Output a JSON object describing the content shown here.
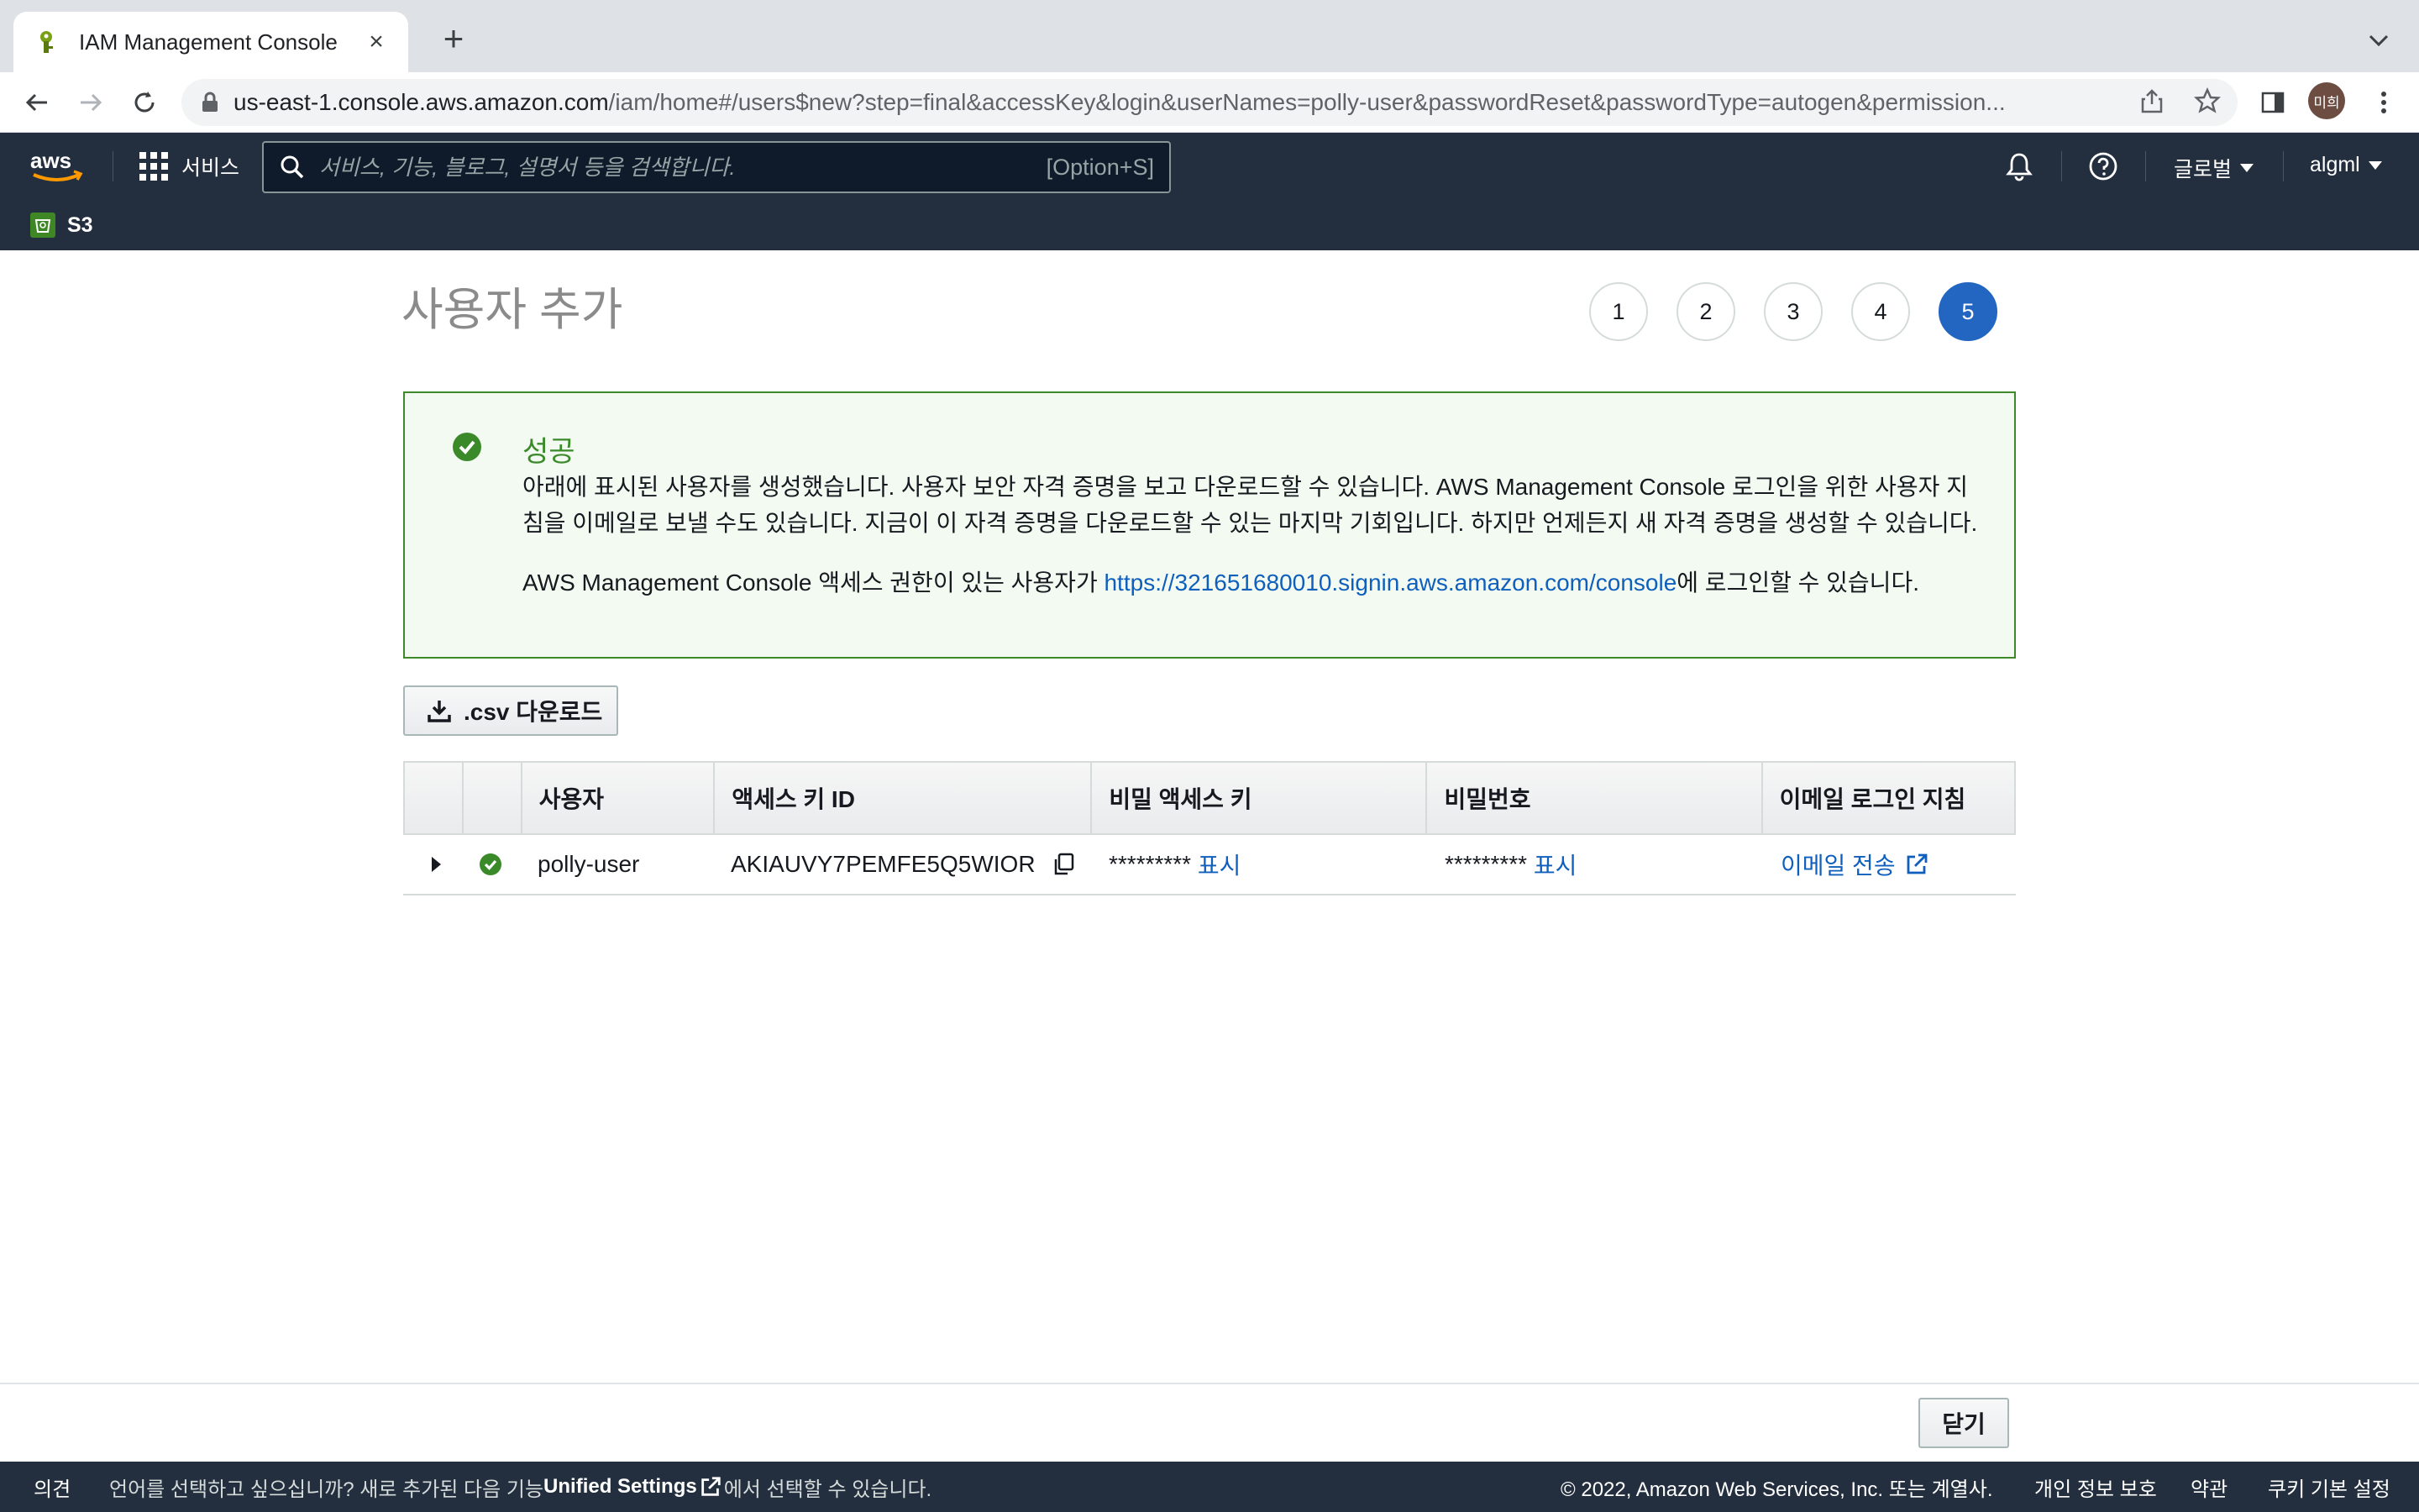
{
  "browser": {
    "tab_title": "IAM Management Console",
    "new_tab": "+",
    "url_host": "us-east-1.console.aws.amazon.com",
    "url_path": "/iam/home#/users$new?step=final&accessKey&login&userNames=polly-user&passwordReset&passwordType=autogen&permission...",
    "profile_initials": "미희"
  },
  "aws_nav": {
    "services_label": "서비스",
    "search_placeholder": "서비스, 기능, 블로그, 설명서 등을 검색합니다.",
    "search_shortcut": "[Option+S]",
    "region": "글로벌",
    "account": "algml",
    "favorites": [
      {
        "label": "S3"
      }
    ]
  },
  "page": {
    "title": "사용자 추가",
    "steps": [
      "1",
      "2",
      "3",
      "4",
      "5"
    ],
    "active_step": "5"
  },
  "alert": {
    "title": "성공",
    "body": "아래에 표시된 사용자를 생성했습니다. 사용자 보안 자격 증명을 보고 다운로드할 수 있습니다. AWS Management Console 로그인을 위한 사용자 지침을 이메일로 보낼 수도 있습니다. 지금이 이 자격 증명을 다운로드할 수 있는 마지막 기회입니다. 하지만 언제든지 새 자격 증명을 생성할 수 있습니다.",
    "console_prefix": "AWS Management Console 액세스 권한이 있는 사용자가 ",
    "console_link": "https://321651680010.signin.aws.amazon.com/console",
    "console_suffix": "에 로그인할 수 있습니다."
  },
  "download_csv_label": ".csv 다운로드",
  "table": {
    "headers": [
      "",
      "",
      "사용자",
      "액세스 키 ID",
      "비밀 액세스 키",
      "비밀번호",
      "이메일 로그인 지침"
    ],
    "rows": [
      {
        "user": "polly-user",
        "access_key_id": "AKIAUVY7PEMFE5Q5WIOR",
        "secret_mask": "*********",
        "secret_show": "표시",
        "password_mask": "*********",
        "password_show": "표시",
        "email_link": "이메일 전송"
      }
    ]
  },
  "close_label": "닫기",
  "footer": {
    "feedback": "의견",
    "lang_prefix": "언어를 선택하고 싶으십니까? 새로 추가된 다음 기능",
    "unified_settings": "Unified Settings",
    "lang_suffix": "에서 선택할 수 있습니다.",
    "copyright": "© 2022, Amazon Web Services, Inc. 또는 계열사.",
    "privacy": "개인 정보 보호",
    "terms": "약관",
    "cookies": "쿠키 기본 설정"
  },
  "colors": {
    "aws_nav_bg": "#232f3e",
    "success_green": "#3b8a2a",
    "link_blue": "#0f5fbd",
    "active_step": "#2366c1"
  }
}
